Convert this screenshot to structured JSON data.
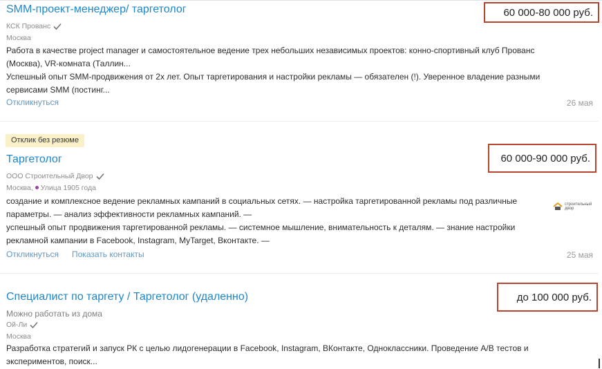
{
  "vacancies": [
    {
      "title": "SMM-проект-менеджер/ таргетолог",
      "salary": "60 000-80 000 руб.",
      "company": "КСК Прованс",
      "location": "Москва",
      "description_1": "Работа в качестве project manager и самостоятельное ведение трех небольших независимых проектов: конно-спортивный клуб Прованс (Москва), VR-комната (Таллин...",
      "description_2": "Успешный опыт SMM-продвижения от 2х лет. Опыт таргетирования и настройки рекламы — обязателен (!). Уверенное владение разными сервисами SMM (постинг...",
      "respond": "Откликнуться",
      "date": "26 мая"
    },
    {
      "badge": "Отклик без резюме",
      "title": "Таргетолог",
      "salary": "60 000-90 000 руб.",
      "company": "ООО Строительный Двор",
      "location": "Москва,",
      "metro": "Улица 1905 года",
      "description_1": "создание и комплексное ведение рекламных кампаний в социальных сетях. — настройка таргетированной рекламы под различные параметры. — анализ эффективности рекламных кампаний. —",
      "description_2": "успешный опыт продвижения таргетированной рекламы. — системное мышление, внимательность к деталям. — знание настройки рекламной кампании в Facebook, Instagram, MyTarget, Вконтакте. —",
      "respond": "Откликнуться",
      "show_contacts": "Показать контакты",
      "date": "25 мая",
      "logo_text_1": "строительный",
      "logo_text_2": "двор"
    },
    {
      "title": "Специалист по таргету / Таргетолог (удаленно)",
      "salary": "до 100 000 руб.",
      "remote": "Можно работать из дома",
      "company": "Ой-Ли",
      "location": "Москва",
      "description_1": "Разработка стратегий и запуск РК с целью лидогенерации в Facebook, Instagram, ВКонтакте, Одноклассники. Проведение А/В тестов и экспериментов, поиск..."
    }
  ],
  "colors": {
    "link": "#1f87c9",
    "highlight_box": "#b7442f",
    "badge_bg": "#fbf1c8",
    "metro_dot": "#9b3fa1"
  }
}
